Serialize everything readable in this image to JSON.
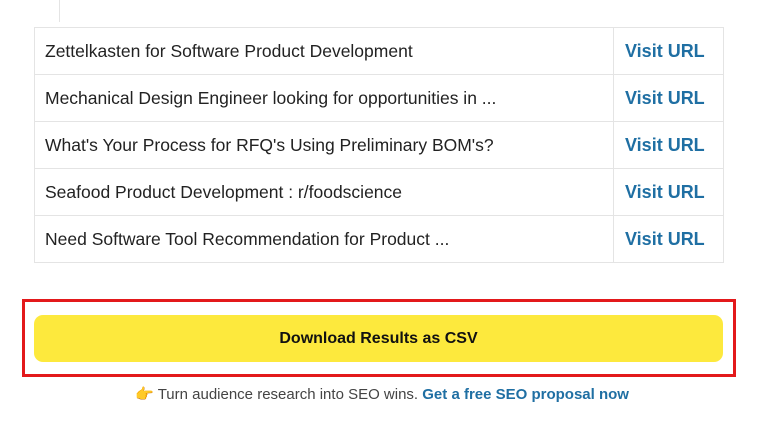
{
  "results": [
    {
      "title": "Zettelkasten for Software Product Development",
      "link_label": "Visit URL"
    },
    {
      "title": "Mechanical Design Engineer looking for opportunities in ...",
      "link_label": "Visit URL"
    },
    {
      "title": "What's Your Process for RFQ's Using Preliminary BOM's?",
      "link_label": "Visit URL"
    },
    {
      "title": "Seafood Product Development : r/foodscience",
      "link_label": "Visit URL"
    },
    {
      "title": "Need Software Tool Recommendation for Product ...",
      "link_label": "Visit URL"
    }
  ],
  "download": {
    "label": "Download Results as CSV"
  },
  "promo": {
    "icon": "pointing-hand-icon",
    "text": "Turn audience research into SEO wins.",
    "link_label": "Get a free SEO proposal now"
  },
  "colors": {
    "link": "#1f6fa3",
    "button": "#fde93d",
    "highlight_border": "#e3191b"
  }
}
